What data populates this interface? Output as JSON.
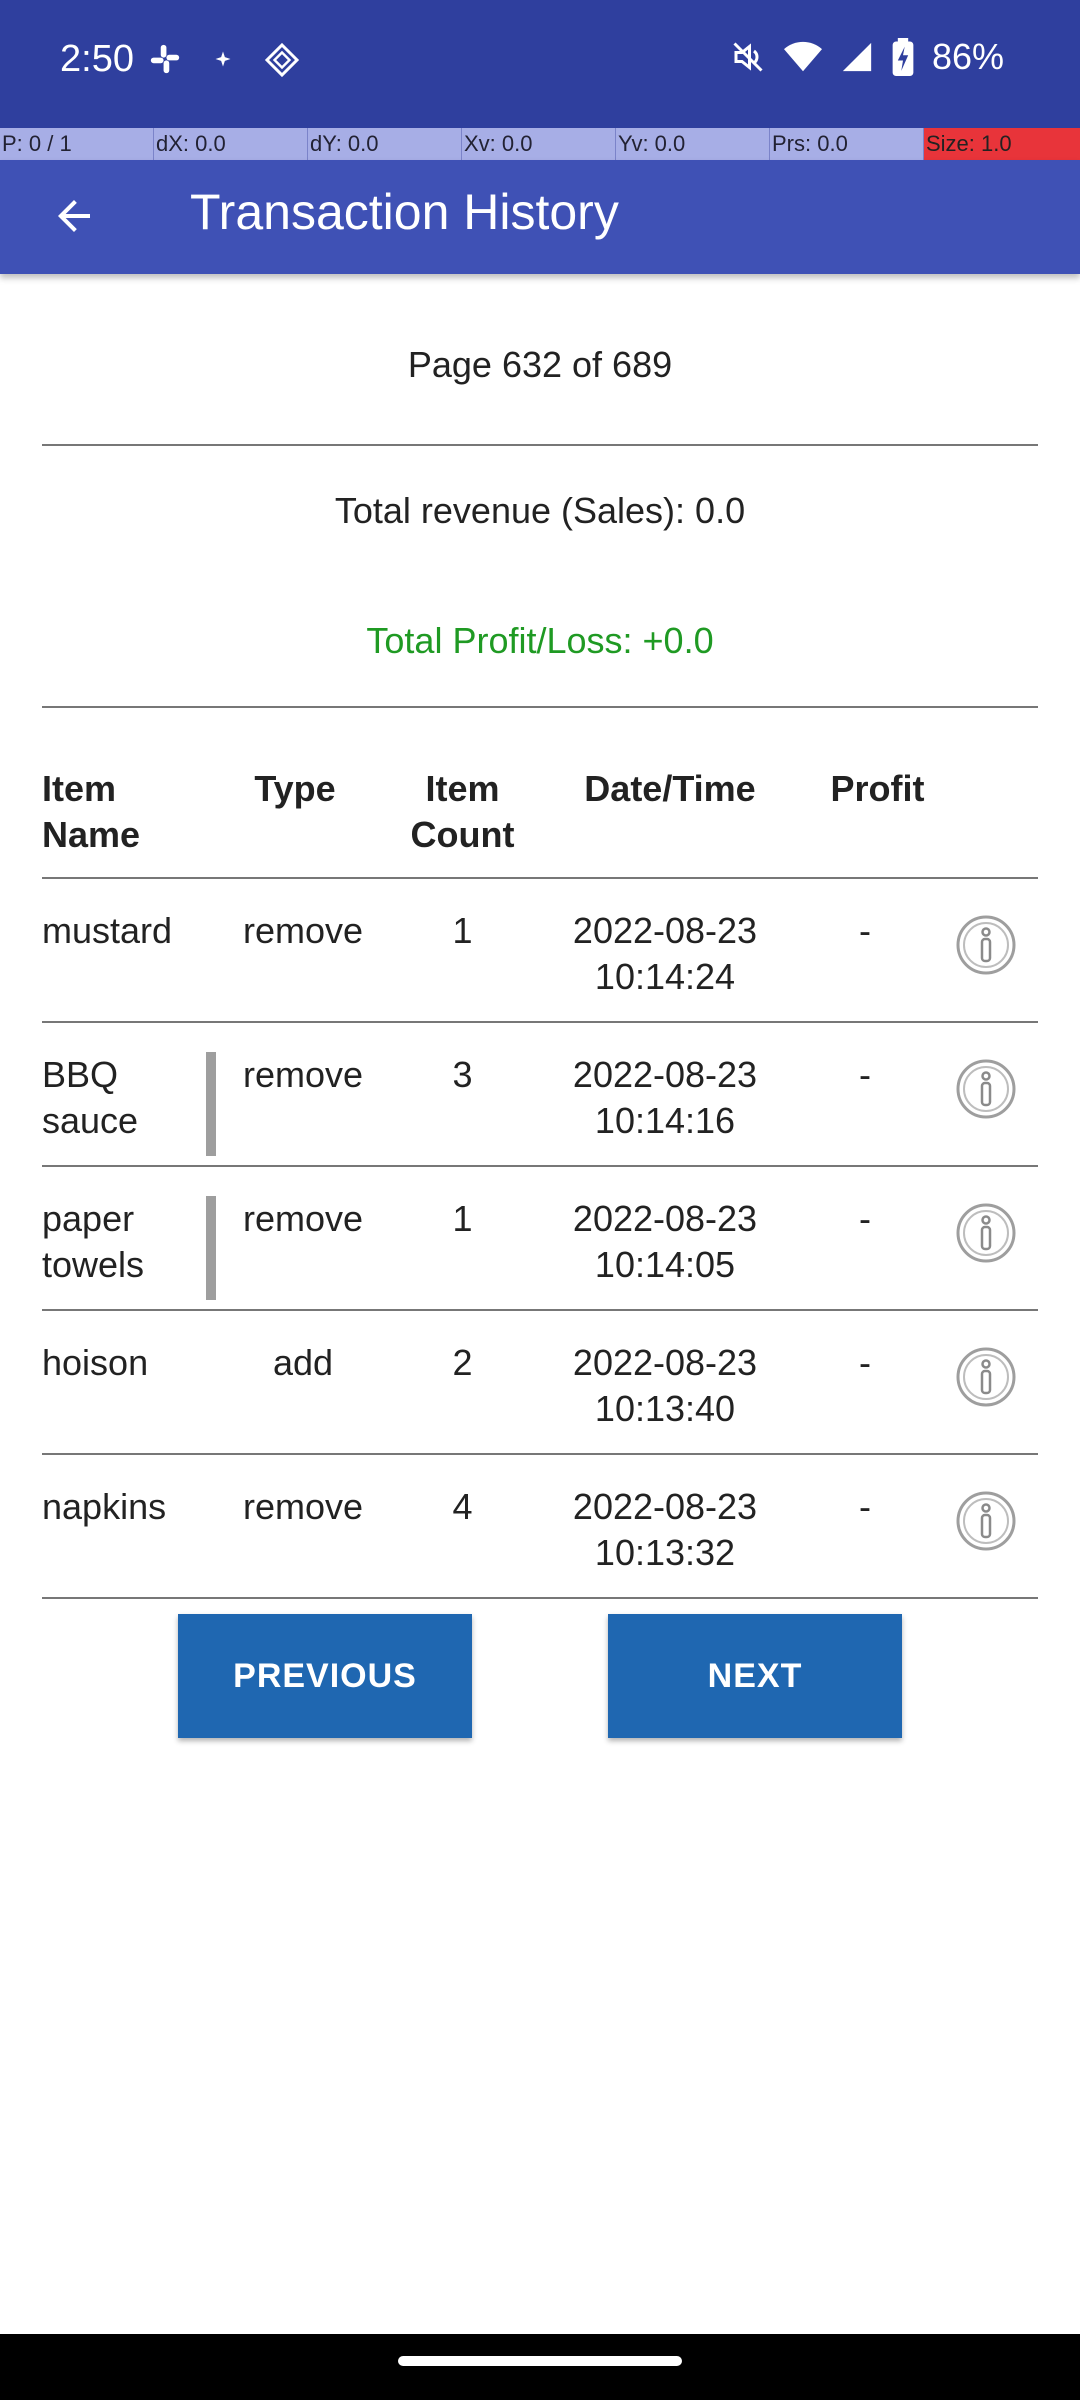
{
  "status_bar": {
    "time": "2:50",
    "battery": "86%",
    "left_icons": [
      "slack-icon",
      "sparkle-icon",
      "diamond-icon"
    ],
    "right_icons": [
      "mute-icon",
      "wifi-icon",
      "signal-icon",
      "battery-icon"
    ]
  },
  "pointer_overlay": {
    "cells": [
      "P: 0 / 1",
      "dX: 0.0",
      "dY: 0.0",
      "Xv: 0.0",
      "Yv: 0.0",
      "Prs: 0.0",
      "Size: 1.0"
    ]
  },
  "app_bar": {
    "title": "Transaction History"
  },
  "summary": {
    "page_indicator": "Page 632 of 689",
    "total_revenue": "Total revenue (Sales): 0.0",
    "total_profit": "Total Profit/Loss: +0.0",
    "profit_color": "#1f9a23"
  },
  "table": {
    "headers": {
      "name": "Item Name",
      "type": "Type",
      "count": "Item Count",
      "date": "Date/Time",
      "profit": "Profit"
    },
    "rows": [
      {
        "name": "mustard",
        "type": "remove",
        "count": "1",
        "date": "2022-08-23 10:14:24",
        "profit": "-"
      },
      {
        "name": "BBQ sauce",
        "type": "remove",
        "count": "3",
        "date": "2022-08-23 10:14:16",
        "profit": "-"
      },
      {
        "name": "paper towels",
        "type": "remove",
        "count": "1",
        "date": "2022-08-23 10:14:05",
        "profit": "-"
      },
      {
        "name": "hoison",
        "type": "add",
        "count": "2",
        "date": "2022-08-23 10:13:40",
        "profit": "-"
      },
      {
        "name": "napkins",
        "type": "remove",
        "count": "4",
        "date": "2022-08-23 10:13:32",
        "profit": "-"
      }
    ]
  },
  "pagination": {
    "previous_label": "PREVIOUS",
    "next_label": "NEXT"
  },
  "colors": {
    "status_bar": "#2f3f9e",
    "app_bar": "#3f51b5",
    "button": "#1f67b1"
  }
}
